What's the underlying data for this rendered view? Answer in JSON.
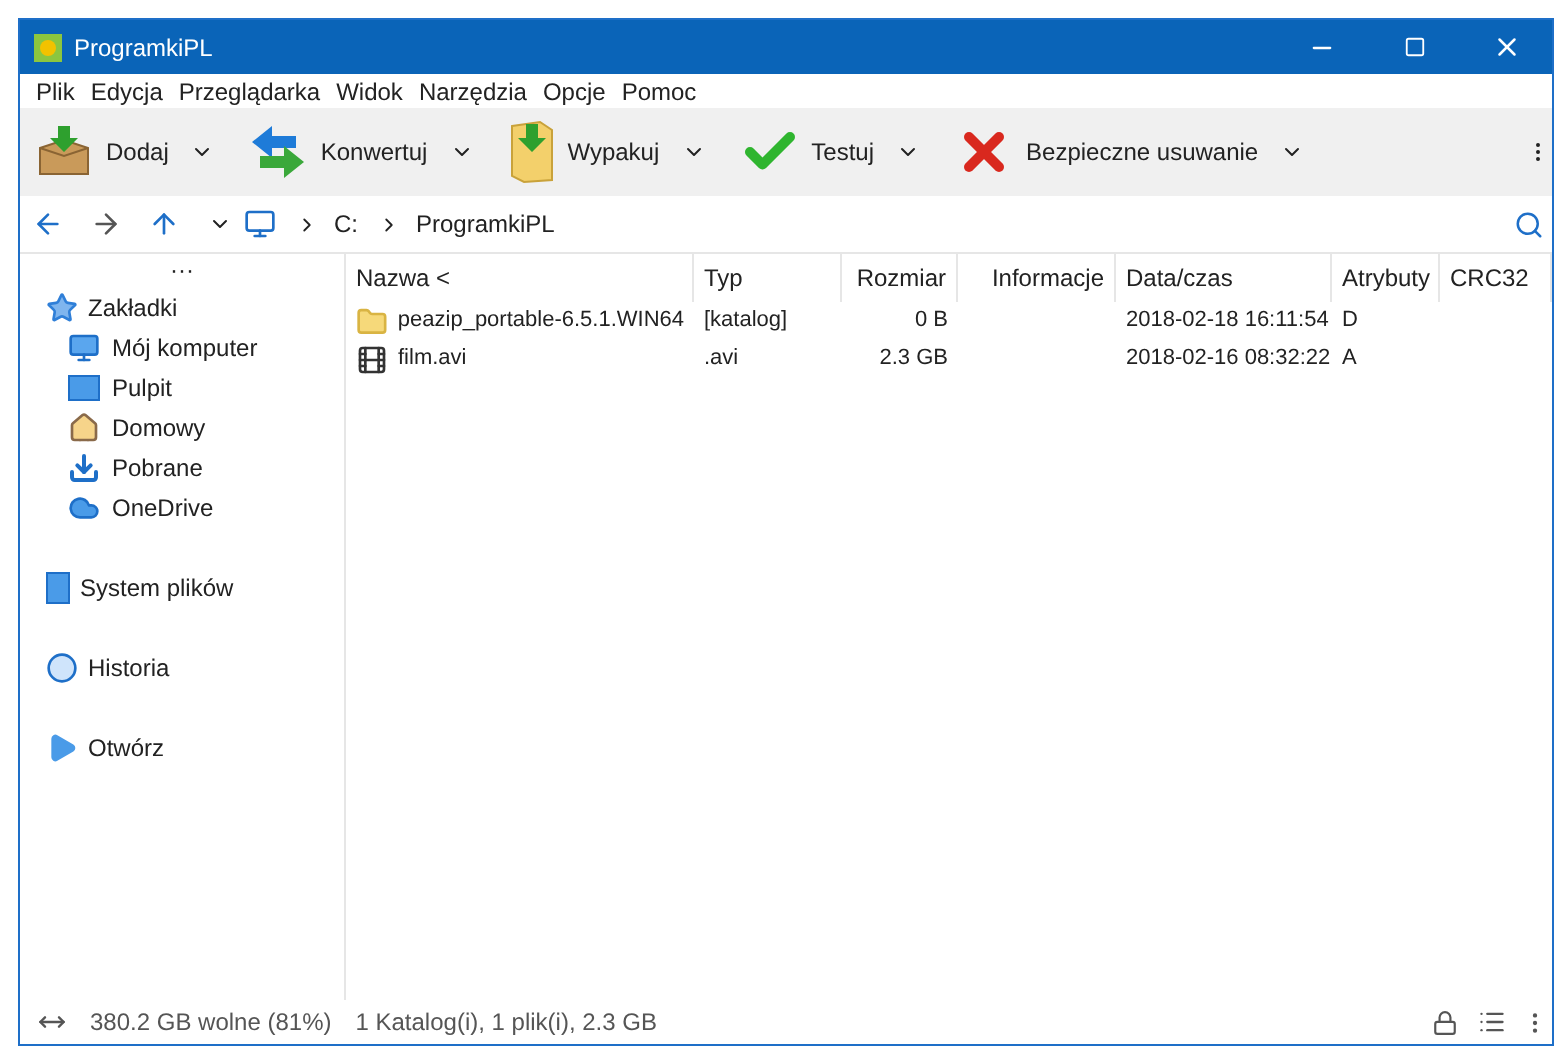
{
  "window": {
    "title": "ProgramkiPL"
  },
  "menu": [
    "Plik",
    "Edycja",
    "Przeglądarka",
    "Widok",
    "Narzędzia",
    "Opcje",
    "Pomoc"
  ],
  "toolbar": [
    {
      "label": "Dodaj",
      "kind": "add"
    },
    {
      "label": "Konwertuj",
      "kind": "convert"
    },
    {
      "label": "Wypakuj",
      "kind": "extract"
    },
    {
      "label": "Testuj",
      "kind": "test"
    },
    {
      "label": "Bezpieczne usuwanie",
      "kind": "delete"
    }
  ],
  "address": {
    "path": [
      "C:",
      "ProgramkiPL"
    ]
  },
  "sidebar": {
    "more": "···",
    "sections": [
      {
        "label": "Zakładki",
        "kind": "bookmarks",
        "children": [
          {
            "label": "Mój komputer",
            "kind": "computer"
          },
          {
            "label": "Pulpit",
            "kind": "desktop"
          },
          {
            "label": "Domowy",
            "kind": "home"
          },
          {
            "label": "Pobrane",
            "kind": "downloads"
          },
          {
            "label": "OneDrive",
            "kind": "cloud"
          }
        ]
      },
      {
        "label": "System plików",
        "kind": "filesystem"
      },
      {
        "label": "Historia",
        "kind": "history"
      },
      {
        "label": "Otwórz",
        "kind": "open"
      }
    ]
  },
  "table": {
    "columns": [
      "Nazwa <",
      "Typ",
      "Rozmiar",
      "Informacje",
      "Data/czas",
      "Atrybuty",
      "CRC32"
    ],
    "rows": [
      {
        "kind": "folder",
        "cells": [
          "peazip_portable-6.5.1.WIN64",
          "[katalog]",
          "0 B",
          "",
          "2018-02-18 16:11:54",
          "D",
          ""
        ]
      },
      {
        "kind": "video",
        "cells": [
          "film.avi",
          ".avi",
          "2.3 GB",
          "",
          "2018-02-16 08:32:22",
          "A",
          ""
        ]
      }
    ]
  },
  "status_bar": {
    "free": "380.2 GB wolne (81%)",
    "summary": "1 Katalog(i), 1 plik(i), 2.3 GB"
  }
}
